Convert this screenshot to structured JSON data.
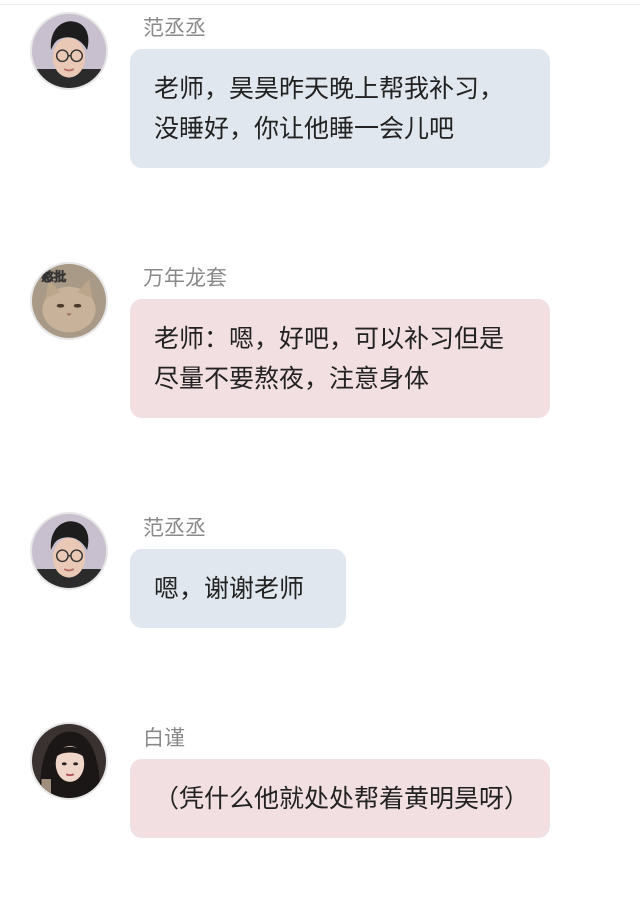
{
  "colors": {
    "bubble_blue": "#e1e7ee",
    "bubble_pink": "#f2dfe1",
    "sender_text": "#8a8a8a"
  },
  "messages": [
    {
      "sender": "范丞丞",
      "avatar": "young-man-glasses-avatar",
      "bubble": "blue",
      "text": "老师，昊昊昨天晚上帮我补习，没睡好，你让他睡一会儿吧"
    },
    {
      "sender": "万年龙套",
      "avatar": "cat-meme-avatar",
      "avatar_caption": "憨批",
      "bubble": "pink",
      "text": "老师：嗯，好吧，可以补习但是尽量不要熬夜，注意身体"
    },
    {
      "sender": "范丞丞",
      "avatar": "young-man-glasses-avatar",
      "bubble": "blue",
      "text": "嗯，谢谢老师"
    },
    {
      "sender": "白谨",
      "avatar": "young-woman-avatar",
      "bubble": "pink",
      "text": "（凭什么他就处处帮着黄明昊呀）"
    }
  ]
}
